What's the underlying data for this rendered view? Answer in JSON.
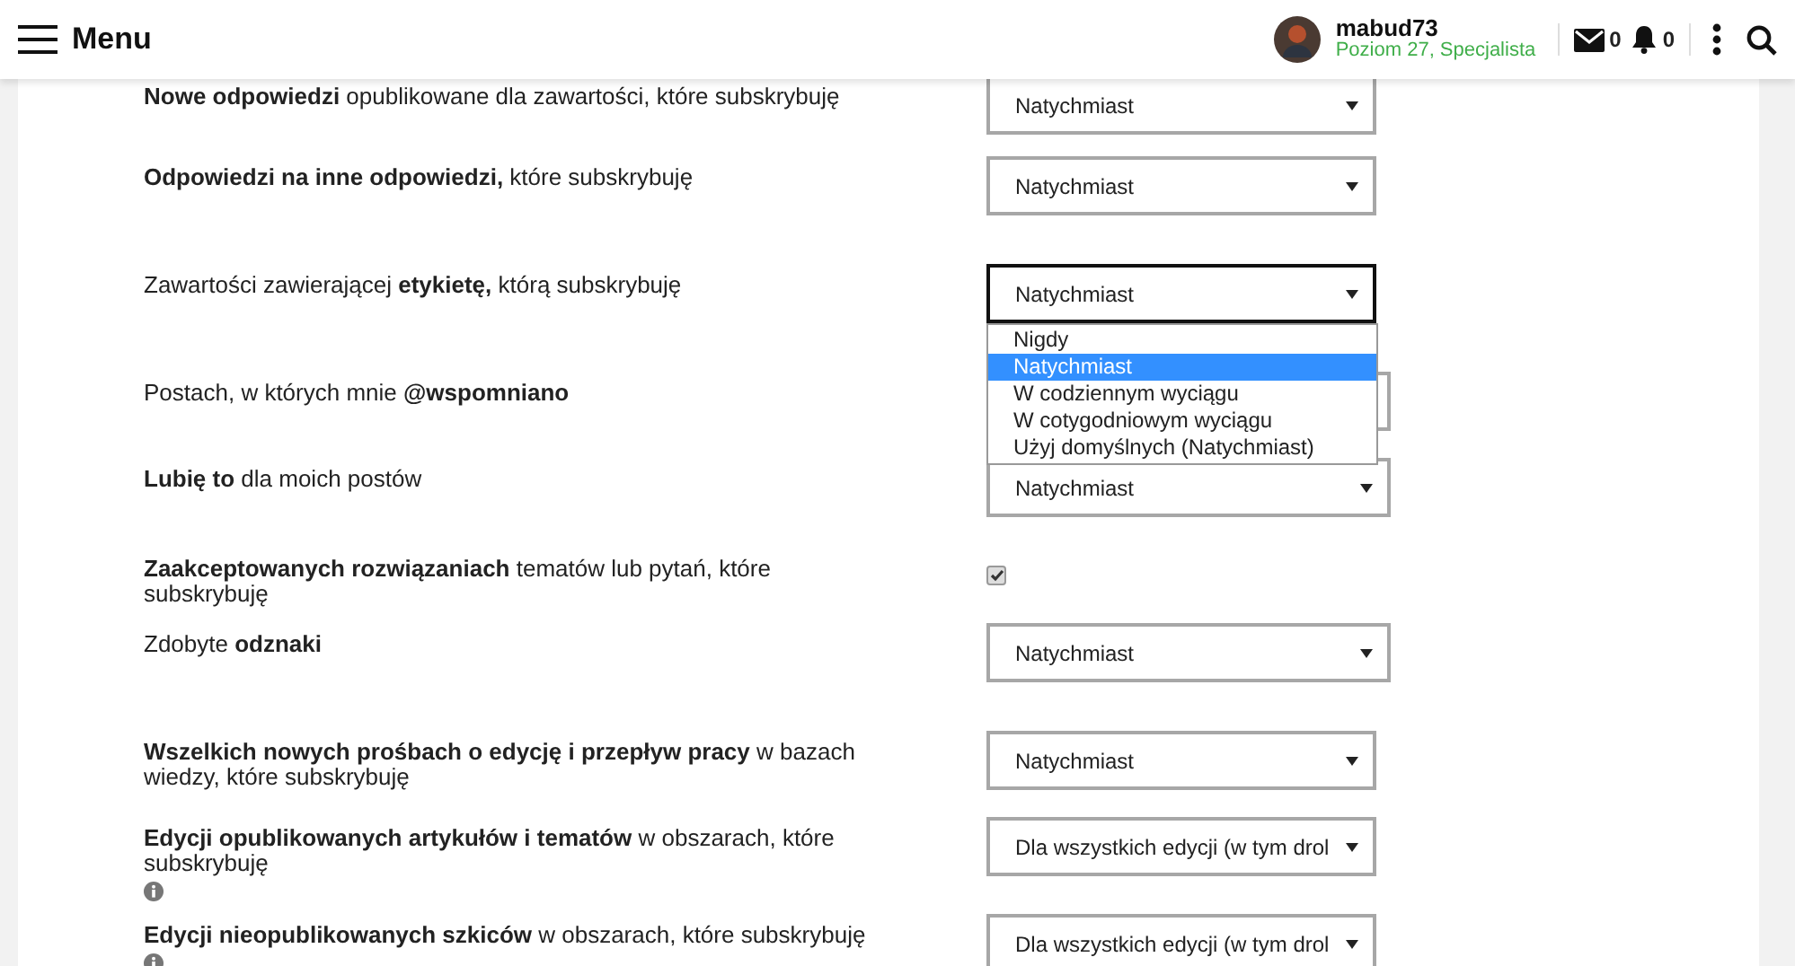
{
  "header": {
    "menu_label": "Menu",
    "user": {
      "name": "mabud73",
      "rank": "Poziom 27, Specjalista"
    },
    "messages_count": "0",
    "notifications_count": "0"
  },
  "rows": [
    {
      "kind": "select",
      "label": "**Nowe odpowiedzi** opublikowane dla zawartości, które subskrybuję",
      "value": "Natychmiast"
    },
    {
      "kind": "select",
      "label": "**Odpowiedzi na inne odpowiedzi,** które subskrybuję",
      "value": "Natychmiast"
    },
    {
      "kind": "select",
      "label": "Zawartości zawierającej **etykietę,** którą subskrybuję",
      "value": "Natychmiast",
      "focused": true,
      "options": [
        {
          "label": "Nigdy",
          "selected": false
        },
        {
          "label": "Natychmiast",
          "selected": true
        },
        {
          "label": "W codziennym wyciągu",
          "selected": false
        },
        {
          "label": "W cotygodniowym wyciągu",
          "selected": false
        },
        {
          "label": "Użyj domyślnych (Natychmiast)",
          "selected": false
        }
      ]
    },
    {
      "kind": "select",
      "label": "Postach, w których mnie **@wspomniano**"
    },
    {
      "kind": "select",
      "label": "**Lubię to** dla moich postów",
      "value": "Natychmiast"
    },
    {
      "kind": "checkbox",
      "label": "**Zaakceptowanych rozwiązaniach** tematów lub pytań, które subskrybuję",
      "checked": true
    },
    {
      "kind": "select",
      "label": "Zdobyte **odznaki**",
      "value": "Natychmiast"
    },
    {
      "kind": "select",
      "label": "**Wszelkich nowych prośbach o edycję i przepływ pracy** w bazach wiedzy, które subskrybuję",
      "value": "Natychmiast"
    },
    {
      "kind": "select",
      "label": "**Edycji opublikowanych artykułów i tematów** w obszarach, które subskrybuję",
      "value": "Dla wszystkich edycji (w tym drol",
      "info": true
    },
    {
      "kind": "select",
      "label": "**Edycji nieopublikowanych szkiców** w obszarach, które subskrybuję",
      "value": "Dla wszystkich edycji (w tym drol",
      "info": true
    }
  ]
}
